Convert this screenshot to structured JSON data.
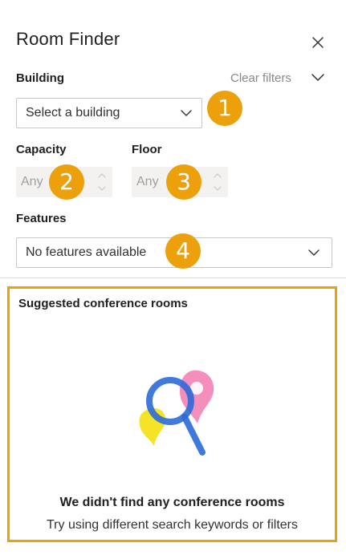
{
  "header": {
    "title": "Room Finder",
    "close_icon": "close-icon"
  },
  "filters": {
    "building": {
      "label": "Building",
      "placeholder": "Select a building",
      "clear_label": "Clear filters"
    },
    "capacity": {
      "label": "Capacity",
      "value": "Any"
    },
    "floor": {
      "label": "Floor",
      "value": "Any"
    },
    "features": {
      "label": "Features",
      "value": "No features available"
    }
  },
  "callouts": [
    "1",
    "2",
    "3",
    "4"
  ],
  "suggestions": {
    "title": "Suggested conference rooms",
    "empty_title": "We didn't find any conference rooms",
    "empty_subtitle": "Try using different search keywords or filters"
  },
  "colors": {
    "callout": "#eba00c",
    "magnifier": "#2b6bd8",
    "pin_pink": "#f27ab0",
    "pin_yellow": "#f4e11b"
  }
}
